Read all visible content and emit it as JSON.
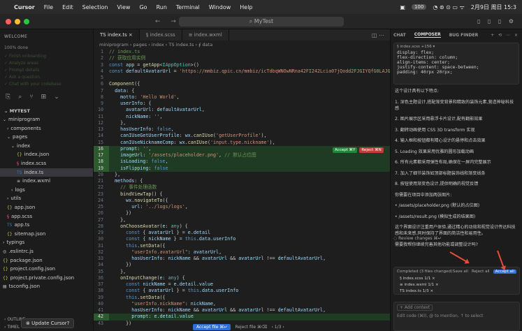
{
  "mac_menu": {
    "apple": "",
    "items": [
      "Cursor",
      "File",
      "Edit",
      "Selection",
      "View",
      "Go",
      "Run",
      "Terminal",
      "Window",
      "Help"
    ],
    "battery": "100",
    "datetime": "2月9日 周日 15:3"
  },
  "window": {
    "search": "⌕ MyTest",
    "nav": "← →",
    "icons": "▯ ▯ ▯ ⚙"
  },
  "sidebar": {
    "header": "WELCOME",
    "progress": "100% done",
    "steps": [
      "✓ Finish onboarding",
      "✓ Analyze areas",
      "✓ Prompt details",
      "✓ Ask a question",
      "✓ Chat with your codebase"
    ],
    "tree_title": "MYTEST",
    "tree": [
      {
        "label": "miniprogram",
        "indent": 4,
        "chev": "⌄",
        "icon": ""
      },
      {
        "label": "components",
        "indent": 10,
        "chev": "›",
        "icon": ""
      },
      {
        "label": "pages",
        "indent": 10,
        "chev": "⌄",
        "icon": ""
      },
      {
        "label": "index",
        "indent": 16,
        "chev": "⌄",
        "icon": ""
      },
      {
        "label": "index.json",
        "indent": 24,
        "chev": "",
        "icon": "{}"
      },
      {
        "label": "index.scss",
        "indent": 24,
        "chev": "",
        "icon": "§"
      },
      {
        "label": "index.ts",
        "indent": 24,
        "chev": "",
        "icon": "TS",
        "active": true
      },
      {
        "label": "index.wxml",
        "indent": 24,
        "chev": "",
        "icon": "≡"
      },
      {
        "label": "logs",
        "indent": 16,
        "chev": "›",
        "icon": ""
      },
      {
        "label": "utils",
        "indent": 10,
        "chev": "›",
        "icon": ""
      },
      {
        "label": "app.json",
        "indent": 10,
        "chev": "",
        "icon": "{}"
      },
      {
        "label": "app.scss",
        "indent": 10,
        "chev": "",
        "icon": "§"
      },
      {
        "label": "app.ts",
        "indent": 10,
        "chev": "",
        "icon": "TS"
      },
      {
        "label": "sitemap.json",
        "indent": 10,
        "chev": "",
        "icon": "{}"
      },
      {
        "label": "typings",
        "indent": 4,
        "chev": "›",
        "icon": ""
      },
      {
        "label": ".eslintrc.js",
        "indent": 4,
        "chev": "",
        "icon": "◎"
      },
      {
        "label": "package.json",
        "indent": 4,
        "chev": "",
        "icon": "{}"
      },
      {
        "label": "project.config.json",
        "indent": 4,
        "chev": "",
        "icon": "{}"
      },
      {
        "label": "project.private.config.json",
        "indent": 4,
        "chev": "",
        "icon": "{}"
      },
      {
        "label": "tsconfig.json",
        "indent": 4,
        "chev": "",
        "icon": "▤"
      }
    ],
    "outline": "OUTLINE",
    "timeline": "TIMEL",
    "update": "Update Cursor?"
  },
  "editor": {
    "tabs": [
      {
        "label": "TS index.ts  ×",
        "active": true
      },
      {
        "label": "§ index.scss",
        "active": false
      },
      {
        "label": "≡ index.wxml",
        "active": false
      }
    ],
    "breadcrumb": "miniprogram › pages › index › TS index.ts › ∮ data",
    "inline_accept": "Accept ⌘Y",
    "inline_reject": "Reject ⌘N",
    "bottom_accept": "Accept file ⌘↵",
    "bottom_reject": "Reject file ⌘⌫",
    "bottom_pager": "1/3"
  },
  "code_lines": [
    {
      "n": 1,
      "h": "<span class='c'>// index.ts</span>"
    },
    {
      "n": 2,
      "h": "<span class='c'>// 获取应用实例</span>"
    },
    {
      "n": 3,
      "h": "<span class='k'>const</span> <span class='v'>app</span> = <span class='f'>getApp</span>&lt;<span class='t'>IAppOption</span>&gt;()"
    },
    {
      "n": 4,
      "h": "<span class='k'>const</span> <span class='v'>defaultAvatarUrl</span> = <span class='s'>'https://mmbiz.qpic.cn/mmbiz/icTdbqWNOwNRna42FI242Lcia07jQodd2FJGIYQfG0LAJGFxM4</span>"
    },
    {
      "n": 5,
      "h": ""
    },
    {
      "n": 6,
      "h": "<span class='f'>Component</span>({"
    },
    {
      "n": 7,
      "h": "  <span class='v'>data</span>: {"
    },
    {
      "n": 8,
      "h": "    <span class='v'>motto</span>: <span class='s'>'Hello World'</span>,"
    },
    {
      "n": 9,
      "h": "    <span class='v'>userInfo</span>: {"
    },
    {
      "n": 10,
      "h": "      <span class='v'>avatarUrl</span>: <span class='v'>defaultAvatarUrl</span>,"
    },
    {
      "n": 11,
      "h": "      <span class='v'>nickName</span>: <span class='s'>''</span>,"
    },
    {
      "n": 12,
      "h": "    },"
    },
    {
      "n": 13,
      "h": "    <span class='v'>hasUserInfo</span>: <span class='k'>false</span>,"
    },
    {
      "n": 14,
      "h": "    <span class='v'>canIUseGetUserProfile</span>: <span class='v'>wx</span>.<span class='f'>canIUse</span>(<span class='s'>'getUserProfile'</span>),"
    },
    {
      "n": 15,
      "h": "    <span class='v'>canIUseNicknameComp</span>: <span class='v'>wx</span>.<span class='f'>canIUse</span>(<span class='s'>'input.type.nickname'</span>),"
    },
    {
      "n": 16,
      "h": "    <span class='v'>prompt</span>: <span class='s'>''</span>,",
      "cls": "add"
    },
    {
      "n": 17,
      "h": "    <span class='v'>imageUrl</span>: <span class='s'>'/assets/placeholder.png'</span>, <span class='c'>// 默认占位图</span>",
      "cls": "add"
    },
    {
      "n": 18,
      "h": "    <span class='v'>isLoading</span>: <span class='k'>false</span>,",
      "cls": "add"
    },
    {
      "n": 19,
      "h": "    <span class='v'>isFlipping</span>: <span class='k'>false</span>",
      "cls": "add"
    },
    {
      "n": 20,
      "h": "  },"
    },
    {
      "n": 21,
      "h": "  <span class='v'>methods</span>: {"
    },
    {
      "n": 22,
      "h": "    <span class='c'>// 事件处理函数</span>"
    },
    {
      "n": 23,
      "h": "    <span class='f'>bindViewTap</span>() {"
    },
    {
      "n": 24,
      "h": "      <span class='v'>wx</span>.<span class='f'>navigateTo</span>({"
    },
    {
      "n": 25,
      "h": "        <span class='v'>url</span>: <span class='s'>'../logs/logs'</span>,"
    },
    {
      "n": 26,
      "h": "      })"
    },
    {
      "n": 27,
      "h": "    },"
    },
    {
      "n": 28,
      "h": "    <span class='f'>onChooseAvatar</span>(<span class='v'>e</span>: <span class='t'>any</span>) {"
    },
    {
      "n": 29,
      "h": "      <span class='k'>const</span> { <span class='v'>avatarUrl</span> } = <span class='v'>e</span>.<span class='v'>detail</span>"
    },
    {
      "n": 30,
      "h": "      <span class='k'>const</span> { <span class='v'>nickName</span> } = <span class='k'>this</span>.<span class='v'>data</span>.<span class='v'>userInfo</span>"
    },
    {
      "n": 31,
      "h": "      <span class='k'>this</span>.<span class='f'>setData</span>({"
    },
    {
      "n": 32,
      "h": "        <span class='s'>\"userInfo.avatarUrl\"</span>: <span class='v'>avatarUrl</span>,"
    },
    {
      "n": 33,
      "h": "        <span class='v'>hasUserInfo</span>: <span class='v'>nickName</span> &amp;&amp; <span class='v'>avatarUrl</span> &amp;&amp; <span class='v'>avatarUrl</span> !== <span class='v'>defaultAvatarUrl</span>,"
    },
    {
      "n": 34,
      "h": "      })"
    },
    {
      "n": 35,
      "h": "    },"
    },
    {
      "n": 36,
      "h": "    <span class='f'>onInputChange</span>(<span class='v'>e</span>: <span class='t'>any</span>) {"
    },
    {
      "n": 37,
      "h": "      <span class='k'>const</span> <span class='v'>nickName</span> = <span class='v'>e</span>.<span class='v'>detail</span>.<span class='v'>value</span>"
    },
    {
      "n": 38,
      "h": "      <span class='k'>const</span> { <span class='v'>avatarUrl</span> } = <span class='k'>this</span>.<span class='v'>data</span>.<span class='v'>userInfo</span>"
    },
    {
      "n": 39,
      "h": "      <span class='k'>this</span>.<span class='f'>setData</span>({"
    },
    {
      "n": 40,
      "h": "        <span class='s'>\"userInfo.nickName\"</span>: <span class='v'>nickName</span>,"
    },
    {
      "n": 41,
      "h": "        <span class='v'>hasUserInfo</span>: <span class='v'>nickName</span> &amp;&amp; <span class='v'>avatarUrl</span> &amp;&amp; <span class='v'>avatarUrl</span> !== <span class='v'>defaultAvatarUrl</span>,"
    },
    {
      "n": 42,
      "h": "        <span class='v'>prompt</span>: <span class='v'>e</span>.<span class='v'>detail</span>.<span class='v'>value</span>",
      "cls": "add"
    },
    {
      "n": 43,
      "h": "      })"
    }
  ],
  "chat": {
    "tabs": [
      "CHAT",
      "COMPOSER",
      "BUG FINDER"
    ],
    "controls": "+ ⟲ ⋯ ×",
    "scss_header": "§ index.scss +156 ▾",
    "scss_lines": [
      "  display: flex;",
      "  flex-direction: column;",
      "  align-items: center;",
      "  justify-content: space-between;",
      "  padding: 40rpx 20rpx;"
    ],
    "messages": [
      "这个设计具有以下特点:",
      "1. 深色主题设计,搭配渐变背景和精致的装饰元素,营造神秘科技感",
      "2. 图片展示区采用悬浮卡片设计,配有翻影效果",
      "3. 翻转动画使用 CSS 3D transform 实现",
      "4. 输入框和按钮都有精心设计的悬停和点击效果",
      "5. Loading 效果采用优雅的圆形加载动画",
      "6. 所有元素都采用弹性布局,确保在一屏内完整展示",
      "7. 加入了细节装饰如顶部标题装饰线和渐变线条",
      "8. 按钮使用渐变色设计,提供明确的视觉反馈",
      "你需要在项目中添加两张图片:",
      "• /assets/placeholder.png (默认的占位图)",
      "• /assets/result.png (模拟生成的结果图)",
      "这个界面设计注重用户体验,通过精心的动效和视觉设计传达科技感和未来感,同时保持了界面的简洁性和易用性。",
      "需要我帮你继续完善其他功能或调整设计吗?"
    ],
    "review": "◌ Review changes ⌘↵",
    "completed": "Completed (3 files changed)",
    "save_all": "Save all",
    "reject_all": "Reject all",
    "accept_all": "Accept all",
    "files": [
      "§ index.scss 1/1 ×",
      "≡ index.wxml 1/1 ×",
      "TS index.ts 1/3 ×"
    ],
    "add_context": "+ Add context",
    "placeholder": "Edit code (⌘I), @ to mention, ↑ to select"
  },
  "colors": {
    "accent": "#2f6fd6",
    "accept_green": "#22863a",
    "reject_red": "#c53b3b",
    "arrow": "#e54d3b"
  }
}
